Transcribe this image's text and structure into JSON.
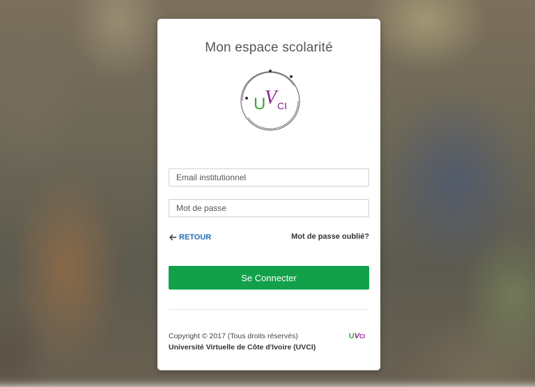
{
  "page": {
    "title": "Mon espace scolarité"
  },
  "logo": {
    "text_u": "U",
    "text_v": "V",
    "text_ci": "CI"
  },
  "form": {
    "email_placeholder": "Email institutionnel",
    "password_placeholder": "Mot de passe",
    "back_label": "RETOUR",
    "forgot_label": "Mot de passe oublié?",
    "submit_label": "Se Connecter"
  },
  "footer": {
    "copyright": "Copyright © 2017 (Tous droits réservés)",
    "org": "Université Virtuelle de Côte d'Ivoire (UVCI)"
  },
  "colors": {
    "accent_green": "#12a14a",
    "link_blue": "#1f6fb5",
    "logo_purple": "#8a1f8a",
    "logo_green": "#3aa63a"
  }
}
